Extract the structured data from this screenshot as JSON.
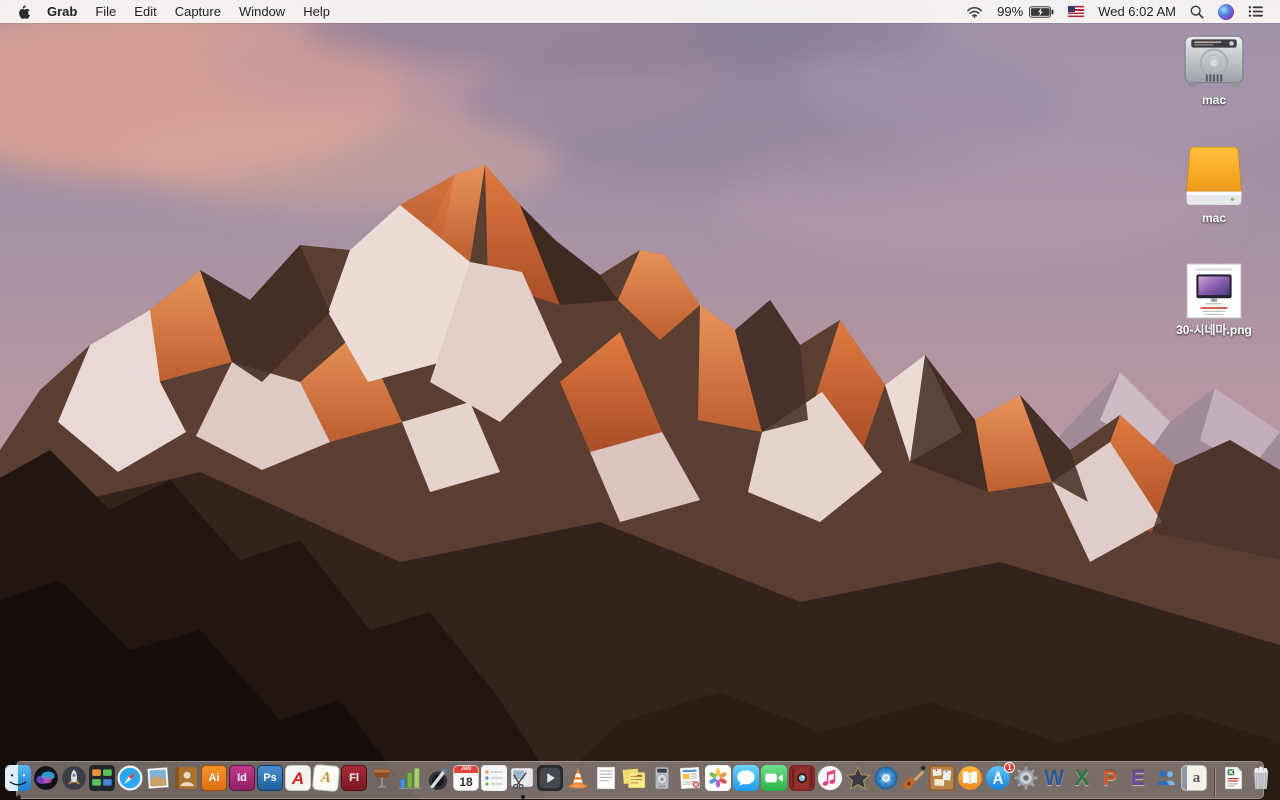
{
  "menu_bar": {
    "app_name": "Grab",
    "menus": [
      "File",
      "Edit",
      "Capture",
      "Window",
      "Help"
    ],
    "status": {
      "battery_percent": "99%",
      "clock": "Wed 6:02 AM"
    },
    "icons": {
      "apple": "apple-logo",
      "wifi": "wifi-icon",
      "battery": "battery-charging-icon",
      "flag": "us-flag-icon",
      "spotlight": "spotlight-search-icon",
      "siri": "siri-icon",
      "notification_center": "notification-center-icon"
    }
  },
  "desktop_icons": [
    {
      "label": "mac",
      "kind": "internal-hard-drive"
    },
    {
      "label": "mac",
      "kind": "external-drive"
    },
    {
      "label": "30-시네마.png",
      "kind": "image-file"
    }
  ],
  "dock": {
    "items": [
      {
        "name": "finder",
        "running": true
      },
      {
        "name": "siri"
      },
      {
        "name": "launchpad"
      },
      {
        "name": "mission-control"
      },
      {
        "name": "safari"
      },
      {
        "name": "preview"
      },
      {
        "name": "contacts"
      },
      {
        "name": "illustrator",
        "glyph": "Ai"
      },
      {
        "name": "indesign",
        "glyph": "Id"
      },
      {
        "name": "photoshop",
        "glyph": "Ps"
      },
      {
        "name": "acrobat",
        "glyph": "A"
      },
      {
        "name": "font-doc",
        "glyph": "A"
      },
      {
        "name": "flash",
        "glyph": "Fl"
      },
      {
        "name": "keynote"
      },
      {
        "name": "numbers"
      },
      {
        "name": "pages"
      },
      {
        "name": "calendar",
        "glyph": "18",
        "glyph2": "JAN"
      },
      {
        "name": "reminders"
      },
      {
        "name": "grab",
        "running": true
      },
      {
        "name": "quicktime"
      },
      {
        "name": "vlc"
      },
      {
        "name": "textedit"
      },
      {
        "name": "stickies"
      },
      {
        "name": "color-meter"
      },
      {
        "name": "newsletter"
      },
      {
        "name": "photos"
      },
      {
        "name": "messages"
      },
      {
        "name": "facetime"
      },
      {
        "name": "photo-booth"
      },
      {
        "name": "itunes"
      },
      {
        "name": "imovie"
      },
      {
        "name": "dvd-player"
      },
      {
        "name": "garageband"
      },
      {
        "name": "corkboard"
      },
      {
        "name": "ibooks"
      },
      {
        "name": "app-store",
        "badge": "1"
      },
      {
        "name": "system-preferences"
      },
      {
        "name": "word",
        "glyph": "W"
      },
      {
        "name": "excel",
        "glyph": "X"
      },
      {
        "name": "powerpoint",
        "glyph": "P"
      },
      {
        "name": "entourage",
        "glyph": "E"
      },
      {
        "name": "messenger"
      },
      {
        "name": "dictionary",
        "glyph": "a"
      },
      {
        "name": "dock-divider",
        "divider": true
      },
      {
        "name": "excel-document"
      },
      {
        "name": "trash"
      }
    ]
  },
  "colors": {
    "menubar_bg": "#f7f4f3",
    "dock_bg": "rgba(186,176,171,0.55)",
    "mountain_orange": "#d4713b",
    "sky_purple": "#9a8da5"
  }
}
